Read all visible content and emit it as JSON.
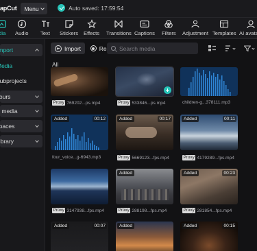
{
  "window": {
    "app_name": "CapCut",
    "menu_label": "Menu",
    "autosave_text": "Auto saved: 17:59:54"
  },
  "toolbar": {
    "items": [
      {
        "label": "Media",
        "icon": "media-icon",
        "active": true
      },
      {
        "label": "Audio",
        "icon": "audio-icon"
      },
      {
        "label": "Text",
        "icon": "text-icon"
      },
      {
        "label": "Stickers",
        "icon": "stickers-icon"
      },
      {
        "label": "Effects",
        "icon": "effects-icon"
      },
      {
        "label": "Transitions",
        "icon": "transitions-icon"
      },
      {
        "label": "Captions",
        "icon": "captions-icon"
      },
      {
        "label": "Filters",
        "icon": "filters-icon"
      },
      {
        "label": "Adjustment",
        "icon": "adjustment-icon"
      },
      {
        "label": "Templates",
        "icon": "templates-icon"
      },
      {
        "label": "AI avatars",
        "icon": "ai-avatars-icon"
      }
    ]
  },
  "sidebar": {
    "items": [
      {
        "label": "Import",
        "expanded": true,
        "selected": true
      },
      {
        "label": "Media",
        "selected": true
      },
      {
        "label": "Subprojects"
      },
      {
        "label": "Yours"
      },
      {
        "label": "AI media"
      },
      {
        "label": "Spaces"
      },
      {
        "label": "Library"
      }
    ]
  },
  "media_header": {
    "import_label": "Import",
    "record_label": "Record",
    "search_placeholder": "Search media"
  },
  "section_label": "All",
  "media_items": [
    {
      "name": "769202...ps.mp4",
      "proxy": "Proxy",
      "added": "",
      "duration": ""
    },
    {
      "name": "533846...ps.mp4",
      "proxy": "Proxy",
      "added": "",
      "duration": ""
    },
    {
      "name": "children-g...378111.mp3",
      "proxy": "",
      "added": "",
      "duration": ""
    },
    {
      "name": "four_voice...g-6943.mp3",
      "proxy": "",
      "added": "Added",
      "duration": "00:12"
    },
    {
      "name": "5669123...fps.mp4",
      "proxy": "Proxy",
      "added": "Added",
      "duration": "00:17"
    },
    {
      "name": "4179289...fps.mp4",
      "proxy": "Proxy",
      "added": "Added",
      "duration": "00:11"
    },
    {
      "name": "3147938...fps.mp4",
      "proxy": "Proxy",
      "added": "",
      "duration": ""
    },
    {
      "name": "288198...fps.mp4",
      "proxy": "Proxy",
      "added": "Added",
      "duration": ""
    },
    {
      "name": "281854...fps.mp4",
      "proxy": "Proxy",
      "added": "Added",
      "duration": "00:23"
    },
    {
      "name": "",
      "proxy": "",
      "added": "Added",
      "duration": "00:07"
    },
    {
      "name": "",
      "proxy": "",
      "added": "Added",
      "duration": ""
    },
    {
      "name": "",
      "proxy": "",
      "added": "Added",
      "duration": "00:15"
    }
  ],
  "colors": {
    "accent": "#27c3b7",
    "audio_thumb": "#10325a",
    "audio_wave": "#2f86d6"
  }
}
